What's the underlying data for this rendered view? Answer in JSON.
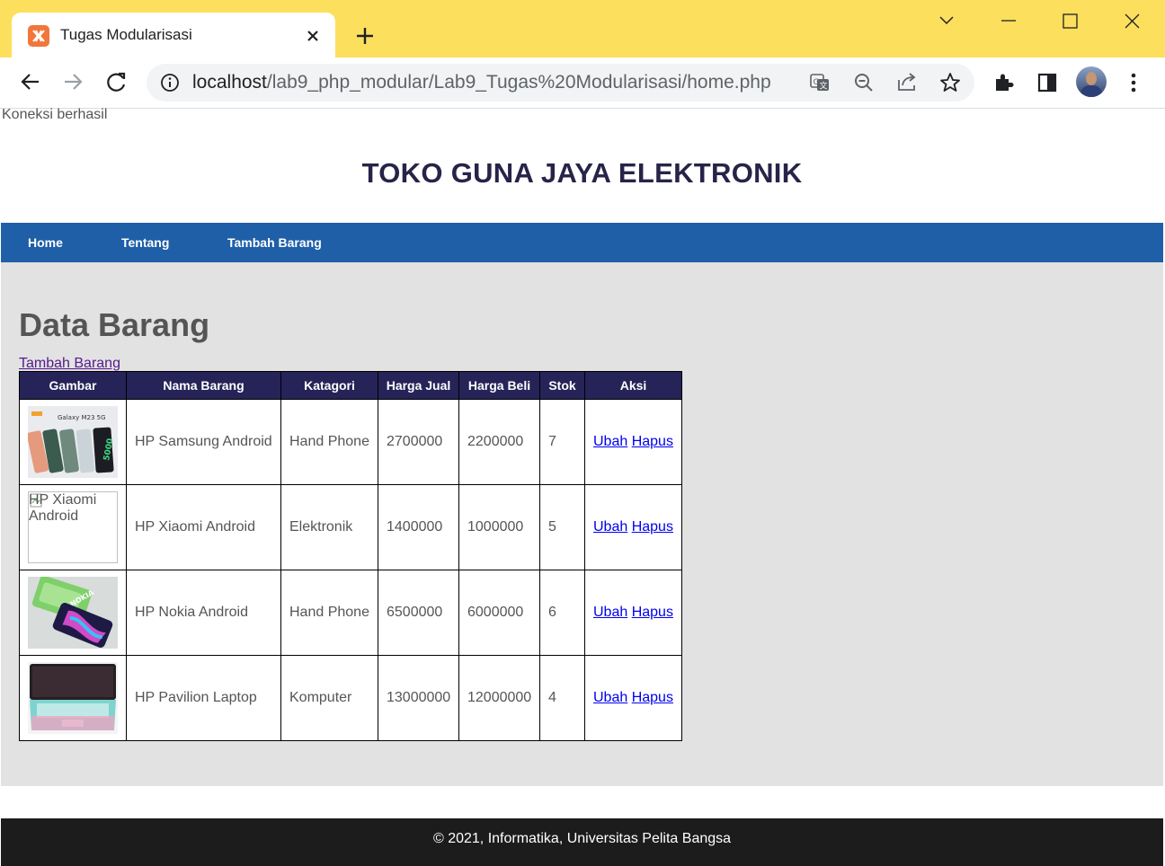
{
  "browser": {
    "tab_title": "Tugas Modularisasi",
    "url_host": "localhost",
    "url_path": "/lab9_php_modular/Lab9_Tugas%20Modularisasi/home.php"
  },
  "page": {
    "connection_status": "Koneksi berhasil",
    "site_title": "TOKO GUNA JAYA ELEKTRONIK",
    "nav": [
      {
        "label": "Home"
      },
      {
        "label": "Tentang"
      },
      {
        "label": "Tambah Barang"
      }
    ],
    "heading": "Data Barang",
    "add_link": "Tambah Barang",
    "table": {
      "headers": [
        "Gambar",
        "Nama Barang",
        "Katagori",
        "Harga Jual",
        "Harga Beli",
        "Stok",
        "Aksi"
      ],
      "rows": [
        {
          "image": "samsung-phones-image",
          "image_caption": "Galaxy M23 5G",
          "nama": "HP Samsung Android",
          "kategori": "Hand Phone",
          "harga_jual": "2700000",
          "harga_beli": "2200000",
          "stok": "7",
          "ubah": "Ubah",
          "hapus": "Hapus"
        },
        {
          "image": "broken-image",
          "image_alt": "HP Xiaomi Android",
          "nama": "HP Xiaomi Android",
          "kategori": "Elektronik",
          "harga_jual": "1400000",
          "harga_beli": "1000000",
          "stok": "5",
          "ubah": "Ubah",
          "hapus": "Hapus"
        },
        {
          "image": "nokia-phone-image",
          "image_caption": "NOKIA",
          "nama": "HP Nokia Android",
          "kategori": "Hand Phone",
          "harga_jual": "6500000",
          "harga_beli": "6000000",
          "stok": "6",
          "ubah": "Ubah",
          "hapus": "Hapus"
        },
        {
          "image": "laptop-image",
          "nama": "HP Pavilion Laptop",
          "kategori": "Komputer",
          "harga_jual": "13000000",
          "harga_beli": "12000000",
          "stok": "4",
          "ubah": "Ubah",
          "hapus": "Hapus"
        }
      ]
    },
    "footer": "© 2021, Informatika, Universitas Pelita Bangsa"
  },
  "colors": {
    "titlebar": "#fddf5e",
    "navbar": "#1f5fa8",
    "table_header": "#262358",
    "content_bg": "#e2e2e3",
    "footer": "#1c1c1c"
  }
}
